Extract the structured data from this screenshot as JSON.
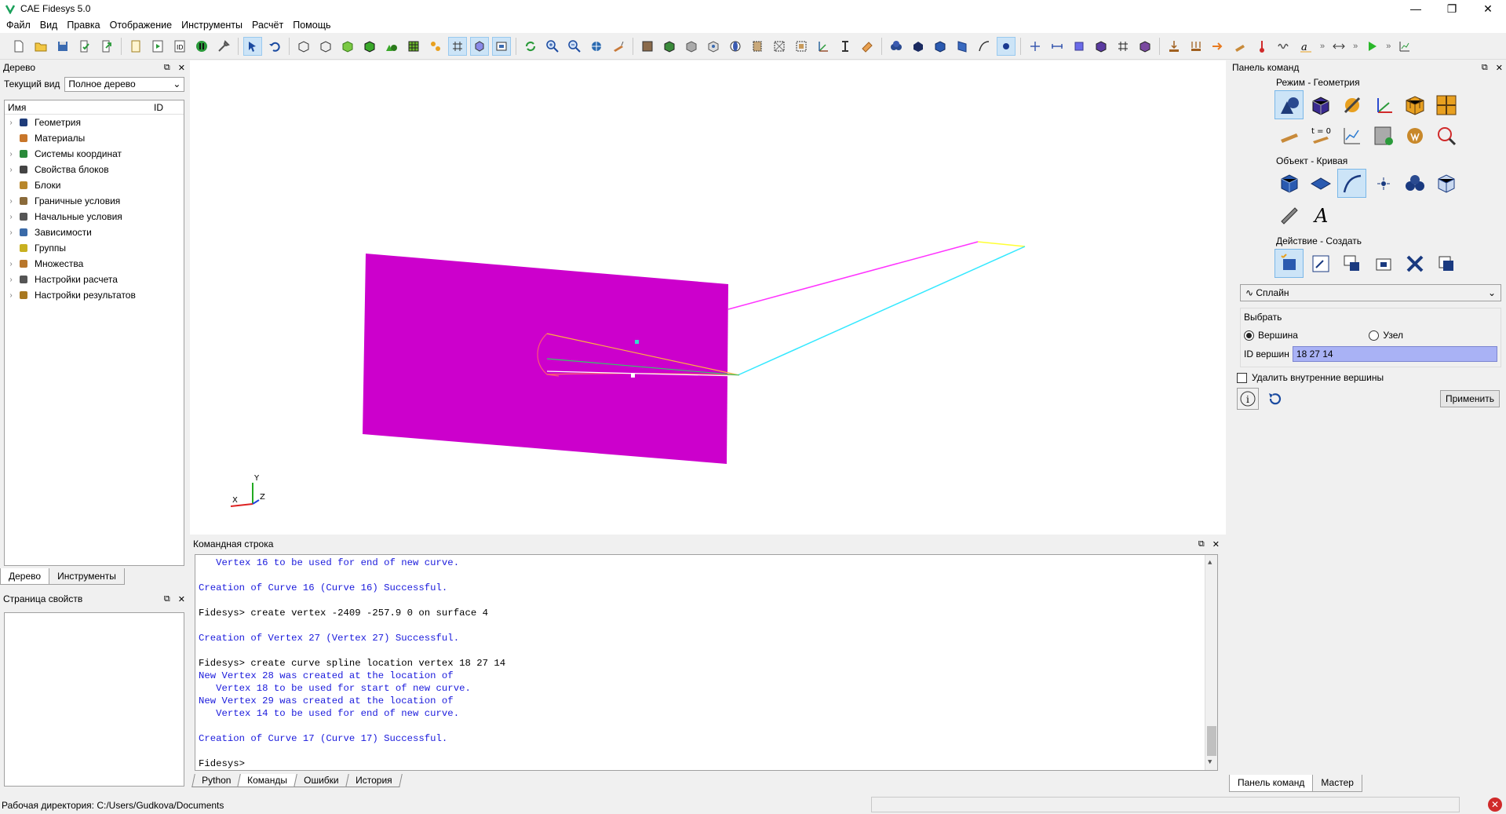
{
  "window": {
    "title": "CAE Fidesys 5.0",
    "minimize": "—",
    "restore": "❐",
    "close": "✕"
  },
  "menu": [
    "Файл",
    "Вид",
    "Правка",
    "Отображение",
    "Инструменты",
    "Расчёт",
    "Помощь"
  ],
  "toolbar": {
    "more_label": "»"
  },
  "tree_panel": {
    "title": "Дерево",
    "current_view_label": "Текущий вид",
    "current_view_value": "Полное дерево",
    "col_name": "Имя",
    "col_id": "ID",
    "items": [
      {
        "label": "Геометрия",
        "icon": "geometry-icon",
        "color": "#1f3c7a"
      },
      {
        "label": "Материалы",
        "icon": "materials-icon",
        "color": "#c8762a"
      },
      {
        "label": "Системы координат",
        "icon": "axes-icon",
        "color": "#2a8a3a"
      },
      {
        "label": "Свойства блоков",
        "icon": "beam-icon",
        "color": "#444444"
      },
      {
        "label": "Блоки",
        "icon": "blocks-icon",
        "color": "#b8862a"
      },
      {
        "label": "Граничные условия",
        "icon": "boundary-icon",
        "color": "#8a6a3a"
      },
      {
        "label": "Начальные условия",
        "icon": "initial-icon",
        "color": "#555555"
      },
      {
        "label": "Зависимости",
        "icon": "chart-icon",
        "color": "#3a6aa8"
      },
      {
        "label": "Группы",
        "icon": "groups-icon",
        "color": "#c8b020"
      },
      {
        "label": "Множества",
        "icon": "sets-icon",
        "color": "#b8762a"
      },
      {
        "label": "Настройки расчета",
        "icon": "calc-settings-icon",
        "color": "#555555"
      },
      {
        "label": "Настройки результатов",
        "icon": "results-settings-icon",
        "color": "#a87820"
      }
    ],
    "tabs": [
      "Дерево",
      "Инструменты"
    ]
  },
  "props_panel": {
    "title": "Страница свойств"
  },
  "command_panel": {
    "title": "Командная строка",
    "lines": [
      {
        "text": "   Vertex 16 to be used for end of new curve.",
        "style": "blue"
      },
      {
        "text": "",
        "style": "gap"
      },
      {
        "text": "Creation of Curve 16 (Curve 16) Successful.",
        "style": "blue"
      },
      {
        "text": "",
        "style": "gap"
      },
      {
        "text": "Fidesys> create vertex -2409 -257.9 0 on surface 4",
        "style": "black"
      },
      {
        "text": "",
        "style": "gap"
      },
      {
        "text": "Creation of Vertex 27 (Vertex 27) Successful.",
        "style": "blue"
      },
      {
        "text": "",
        "style": "gap"
      },
      {
        "text": "Fidesys> create curve spline location vertex 18 27 14",
        "style": "black"
      },
      {
        "text": "New Vertex 28 was created at the location of",
        "style": "blue"
      },
      {
        "text": "   Vertex 18 to be used for start of new curve.",
        "style": "blue"
      },
      {
        "text": "New Vertex 29 was created at the location of",
        "style": "blue"
      },
      {
        "text": "   Vertex 14 to be used for end of new curve.",
        "style": "blue"
      },
      {
        "text": "",
        "style": "gap"
      },
      {
        "text": "Creation of Curve 17 (Curve 17) Successful.",
        "style": "blue"
      },
      {
        "text": "",
        "style": "gap"
      },
      {
        "text": "Fidesys> ",
        "style": "black"
      }
    ],
    "tabs": [
      "Python",
      "Команды",
      "Ошибки",
      "История"
    ],
    "active_tab": "Команды"
  },
  "right_panel": {
    "title": "Панель команд",
    "mode_title": "Режим - Геометрия",
    "object_title": "Объект - Кривая",
    "action_title": "Действие - Создать",
    "curve_type": "Сплайн",
    "select_title": "Выбрать",
    "radio_vertex": "Вершина",
    "radio_node": "Узел",
    "id_label": "ID вершин",
    "id_value": "18 27 14",
    "delete_inner_label": "Удалить внутренние вершины",
    "apply_label": "Применить",
    "bottom_tabs": [
      "Панель команд",
      "Мастер"
    ]
  },
  "axes": {
    "x": "X",
    "y": "Y",
    "z": "Z"
  },
  "status": {
    "workdir": "Рабочая директория: C:/Users/Gudkova/Documents"
  }
}
